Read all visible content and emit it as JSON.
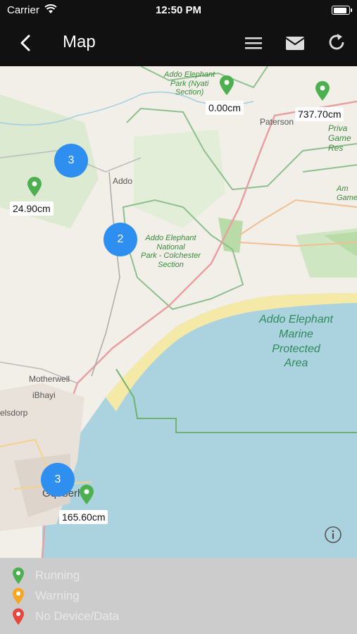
{
  "status": {
    "carrier": "Carrier",
    "time": "12:50 PM"
  },
  "nav": {
    "title": "Map"
  },
  "map": {
    "places": {
      "paterson": "Paterson",
      "addo": "Addo",
      "motherwell": "Motherwell",
      "ibhayi": "iBhayi",
      "elsdorp": "elsdorp",
      "gqeberha": "Gqeberha"
    },
    "parks": {
      "nyati_line1": "Addo Elephant",
      "nyati_line2": "Park (Nyati",
      "nyati_line3": "Section)",
      "colchester_line1": "Addo Elephant",
      "colchester_line2": "National",
      "colchester_line3": "Park - Colchester",
      "colchester_line4": "Section",
      "private_line1": "Priva",
      "private_line2": "Game Res",
      "ami_line1": "Am",
      "ami_line2": "Game",
      "marine_line1": "Addo Elephant",
      "marine_line2": "Marine",
      "marine_line3": "Protected",
      "marine_line4": "Area"
    },
    "clusters": [
      {
        "count": "3"
      },
      {
        "count": "2"
      },
      {
        "count": "3"
      }
    ],
    "markers": [
      {
        "reading": "0.00cm",
        "status": "Running"
      },
      {
        "reading": "737.70cm",
        "status": "Running"
      },
      {
        "reading": "24.90cm",
        "status": "Running"
      },
      {
        "reading": "165.60cm",
        "status": "Running"
      }
    ]
  },
  "legend": {
    "items": [
      {
        "label": "Running",
        "color": "#4caf50"
      },
      {
        "label": "Warning",
        "color": "#f5a623"
      },
      {
        "label": "No Device/Data",
        "color": "#e8453c"
      }
    ]
  },
  "colors": {
    "running": "#4caf50",
    "warning": "#f5a623",
    "no_device": "#e8453c",
    "cluster": "#2f8ff0",
    "sea": "#aad3df",
    "park": "#cfe6c2"
  }
}
